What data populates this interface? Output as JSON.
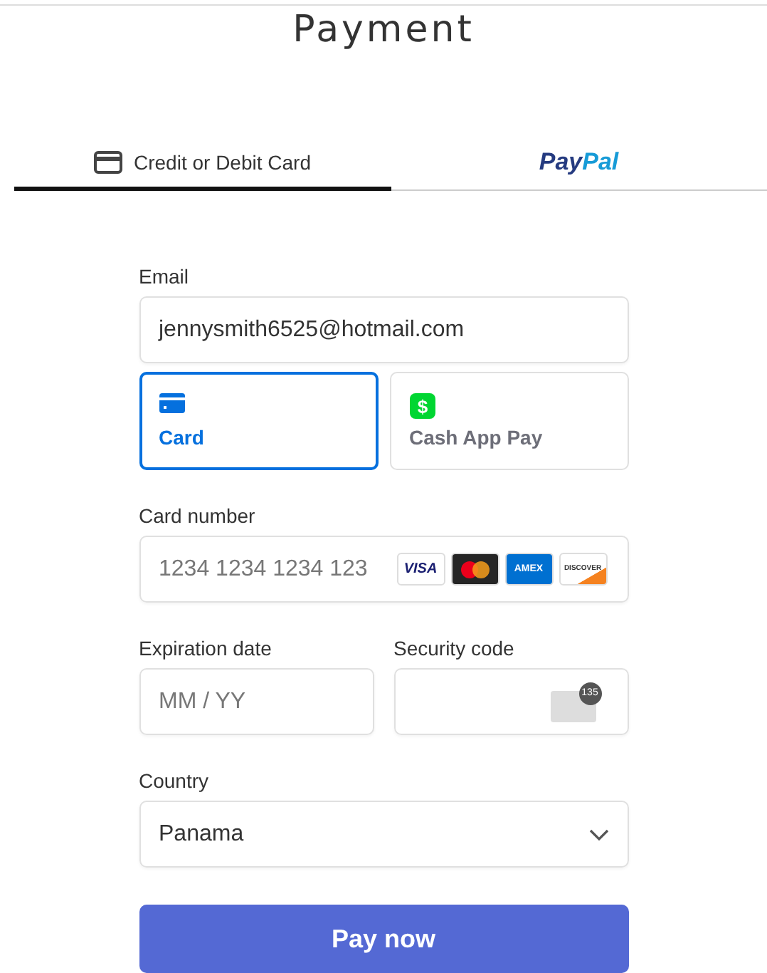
{
  "title": "Payment",
  "tabs": [
    {
      "kind": "card",
      "label": "Credit or Debit Card",
      "selected": true
    },
    {
      "kind": "paypal",
      "label_parts": [
        "Pay",
        "Pal"
      ],
      "selected": false
    }
  ],
  "email": {
    "label": "Email",
    "value": "jennysmith6525@hotmail.com"
  },
  "methods": [
    {
      "kind": "card",
      "label": "Card",
      "selected": true
    },
    {
      "kind": "cashapp",
      "label": "Cash App Pay",
      "icon_text": "$",
      "selected": false
    }
  ],
  "card_number": {
    "label": "Card number",
    "placeholder": "1234 1234 1234 123"
  },
  "brands": [
    {
      "kind": "visa",
      "label": "VISA"
    },
    {
      "kind": "mastercard"
    },
    {
      "kind": "amex",
      "label": "AMEX"
    },
    {
      "kind": "discover",
      "label": "DISCOVER"
    }
  ],
  "expiration": {
    "label": "Expiration date",
    "placeholder": "MM / YY"
  },
  "security": {
    "label": "Security code",
    "badge": "135"
  },
  "country": {
    "label": "Country",
    "value": "Panama"
  },
  "button": "Pay now"
}
